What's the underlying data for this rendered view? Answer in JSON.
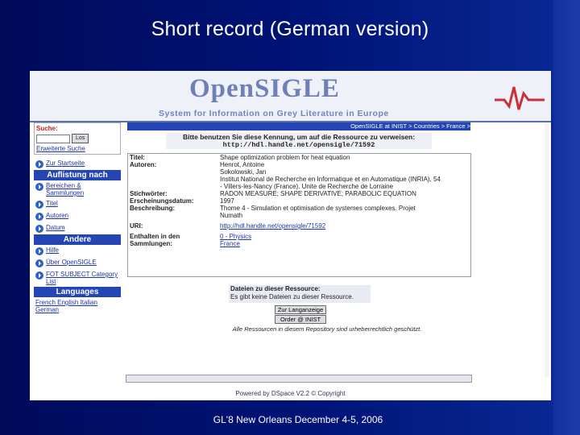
{
  "slide": {
    "title": "Short record (German version)",
    "caption": "GL'8 New Orleans December 4-5, 2006"
  },
  "site": {
    "logo": "OpenSIGLE",
    "tagline": "System for Information on Grey Literature in Europe"
  },
  "sidebar": {
    "search_label": "Suche:",
    "search_value": "",
    "go_button": "Los",
    "advanced_link": "Erweiterte Suche",
    "home_link": "Zur Startseite",
    "browse_header": "Auflistung nach",
    "browse_items": [
      {
        "label": "Bereichen & Sammlungen",
        "icon": "arrow-icon"
      },
      {
        "label": "Titel",
        "icon": "arrow-icon"
      },
      {
        "label": "Autoren",
        "icon": "arrow-icon"
      },
      {
        "label": "Datum",
        "icon": "arrow-icon"
      }
    ],
    "other_header": "Andere",
    "other_items": [
      {
        "label": "Hilfe",
        "icon": "arrow-icon"
      },
      {
        "label": "Über OpenSIGLE",
        "icon": "arrow-icon"
      },
      {
        "label": "FOT SUBJECT Category List",
        "icon": "arrow-icon"
      }
    ],
    "languages_header": "Languages",
    "languages": "French English Italian German"
  },
  "content": {
    "breadcrumb": "OpenSIGLE at INIST > Countries > France >",
    "handle_notice": "Bitte benutzen Sie diese Kennung, um auf die Ressource zu verweisen:",
    "handle_url": "http://hdl.handle.net/opensigle/71592",
    "fields": [
      {
        "label": "Titel:",
        "value": "Shape optimization problem for heat equation",
        "link": false
      },
      {
        "label": "Autoren:",
        "value": "Henrot, Antoine",
        "link": false
      },
      {
        "label": "",
        "value": "Sokolowski, Jan",
        "link": false
      },
      {
        "label": "",
        "value": "Institut National de Recherche en Informatique et en Automatique (INRIA), 54",
        "link": false
      },
      {
        "label": "",
        "value": "- Villers-les-Nancy (France). Unite de Recherche de Lorraine",
        "link": false
      },
      {
        "label": "Stichwörter:",
        "value": "RADON MEASURE; SHAPE DERIVATIVE; PARABOLIC EQUATION",
        "link": false
      },
      {
        "label": "Erscheinungsdatum:",
        "value": "1997",
        "link": false
      },
      {
        "label": "Beschreibung:",
        "value": "Thome 4 - Simulation et optimisation de systemes complexes. Projet",
        "link": false
      },
      {
        "label": "",
        "value": "Numath",
        "link": false
      },
      {
        "label": "URI:",
        "value": "http://hdl.handle.net/opensigle/71592",
        "link": true
      },
      {
        "label": "Enthalten in den",
        "value": "0 - Physics",
        "link": true
      },
      {
        "label": "Sammlungen:",
        "value": "France",
        "link": true
      }
    ],
    "files_header": "Dateien zu dieser Ressource:",
    "files_note": "Es gibt keine Dateien zu dieser Ressource.",
    "button_full": "Zur Langanzeige",
    "button_order": "Order @ INIST",
    "rights_note": "Alle Ressourcen in diesem Repository sind urheberrechtlich geschützt.",
    "footer": "Powered by DSpace V2.2 © Copyright"
  }
}
